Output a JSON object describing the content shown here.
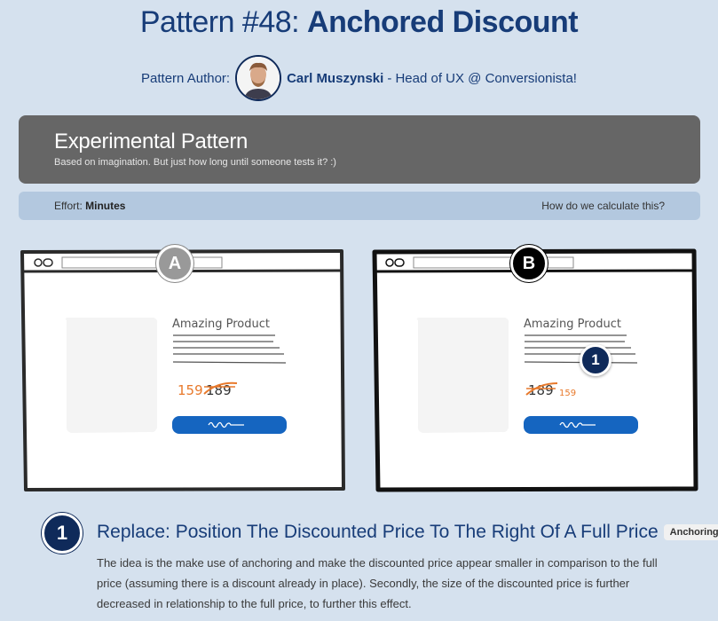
{
  "header": {
    "title_prefix": "Pattern #48: ",
    "title_main": "Anchored Discount",
    "author_label": "Pattern Author:",
    "author_name": "Carl Muszynski",
    "author_role": " - Head of UX @ Conversionista!"
  },
  "experiment": {
    "title": "Experimental Pattern",
    "subtitle": "Based on imagination. But just how long until someone tests it? :)"
  },
  "effort": {
    "label": "Effort:",
    "value": "Minutes",
    "link": "How do we calculate this?"
  },
  "variants": {
    "a": {
      "badge": "A",
      "product": "Amazing Product",
      "price_new": "159",
      "price_old": "189"
    },
    "b": {
      "badge": "B",
      "product": "Amazing Product",
      "price_old": "189",
      "price_new": "159",
      "marker": "1"
    }
  },
  "change": {
    "number": "1",
    "title": "Replace: Position The Discounted Price To The Right Of A Full Price",
    "tag": "Anchoring",
    "description": "The idea is the make use of anchoring and make the discounted price appear smaller in comparison to the full price (assuming there is a discount already in place). Secondly, the size of the discounted price is further decreased in relationship to the full price, to further this effect."
  },
  "colors": {
    "background": "#d5e1ee",
    "navy": "#0f2a5a",
    "discount_orange": "#e8792b",
    "cta_blue": "#1565c0",
    "experiment_box": "#666666"
  }
}
